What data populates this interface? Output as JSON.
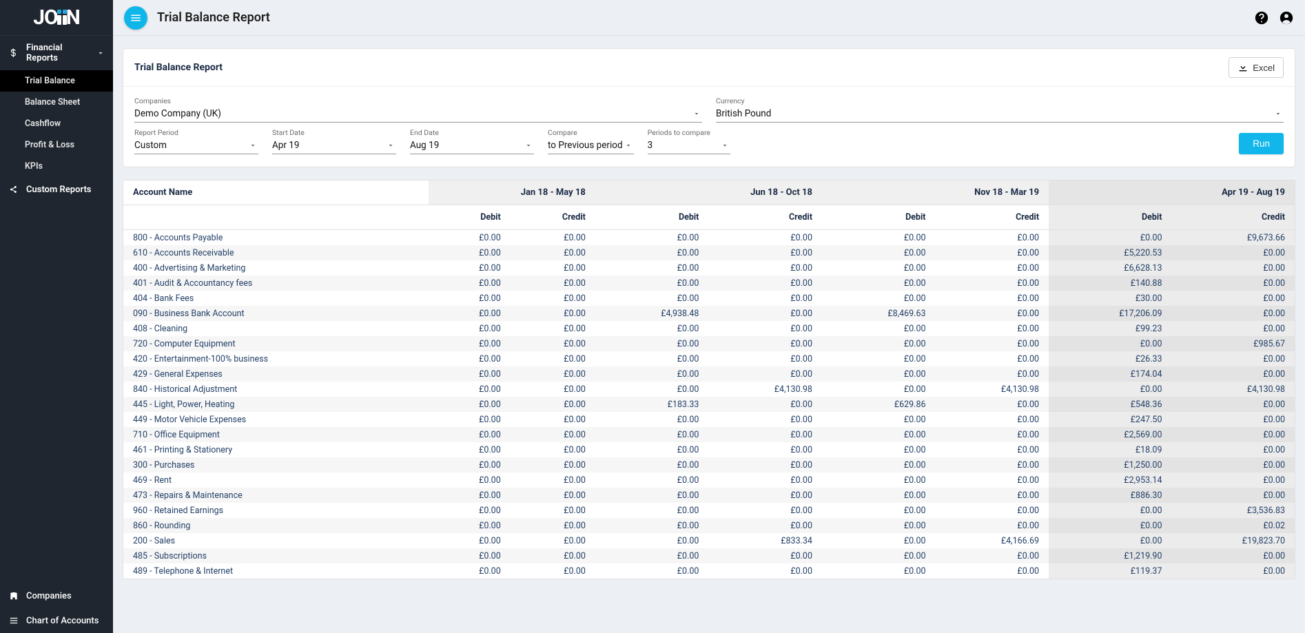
{
  "app": {
    "logo_text_left": "JO",
    "logo_text_right": "N",
    "page_title": "Trial Balance Report"
  },
  "sidebar": {
    "financial_reports_label": "Financial Reports",
    "items": [
      {
        "label": "Trial Balance",
        "active": true
      },
      {
        "label": "Balance Sheet",
        "active": false
      },
      {
        "label": "Cashflow",
        "active": false
      },
      {
        "label": "Profit & Loss",
        "active": false
      },
      {
        "label": "KPIs",
        "active": false
      }
    ],
    "custom_reports_label": "Custom Reports",
    "bottom": {
      "companies_label": "Companies",
      "coa_label": "Chart of Accounts"
    }
  },
  "report_card": {
    "title": "Trial Balance Report",
    "excel_label": "Excel",
    "filters": {
      "companies": {
        "label": "Companies",
        "value": "Demo Company (UK)"
      },
      "currency": {
        "label": "Currency",
        "value": "British Pound"
      },
      "report_period": {
        "label": "Report Period",
        "value": "Custom"
      },
      "start_date": {
        "label": "Start Date",
        "value": "Apr 19"
      },
      "end_date": {
        "label": "End Date",
        "value": "Aug 19"
      },
      "compare": {
        "label": "Compare",
        "value": "to Previous period"
      },
      "periods_to_compare": {
        "label": "Periods to compare",
        "value": "3"
      },
      "run_label": "Run"
    }
  },
  "table": {
    "account_header": "Account Name",
    "debit_label": "Debit",
    "credit_label": "Credit",
    "periods": [
      {
        "label": "Jan 18 - May 18",
        "current": false
      },
      {
        "label": "Jun 18 - Oct 18",
        "current": false
      },
      {
        "label": "Nov 18 - Mar 19",
        "current": false
      },
      {
        "label": "Apr 19 - Aug 19",
        "current": true
      }
    ],
    "rows": [
      {
        "name": "800 - Accounts Payable",
        "cells": [
          "£0.00",
          "£0.00",
          "£0.00",
          "£0.00",
          "£0.00",
          "£0.00",
          "£0.00",
          "£9,673.66"
        ]
      },
      {
        "name": "610 - Accounts Receivable",
        "cells": [
          "£0.00",
          "£0.00",
          "£0.00",
          "£0.00",
          "£0.00",
          "£0.00",
          "£5,220.53",
          "£0.00"
        ]
      },
      {
        "name": "400 - Advertising & Marketing",
        "cells": [
          "£0.00",
          "£0.00",
          "£0.00",
          "£0.00",
          "£0.00",
          "£0.00",
          "£6,628.13",
          "£0.00"
        ]
      },
      {
        "name": "401 - Audit & Accountancy fees",
        "cells": [
          "£0.00",
          "£0.00",
          "£0.00",
          "£0.00",
          "£0.00",
          "£0.00",
          "£140.88",
          "£0.00"
        ]
      },
      {
        "name": "404 - Bank Fees",
        "cells": [
          "£0.00",
          "£0.00",
          "£0.00",
          "£0.00",
          "£0.00",
          "£0.00",
          "£30.00",
          "£0.00"
        ]
      },
      {
        "name": "090 - Business Bank Account",
        "cells": [
          "£0.00",
          "£0.00",
          "£4,938.48",
          "£0.00",
          "£8,469.63",
          "£0.00",
          "£17,206.09",
          "£0.00"
        ]
      },
      {
        "name": "408 - Cleaning",
        "cells": [
          "£0.00",
          "£0.00",
          "£0.00",
          "£0.00",
          "£0.00",
          "£0.00",
          "£99.23",
          "£0.00"
        ]
      },
      {
        "name": "720 - Computer Equipment",
        "cells": [
          "£0.00",
          "£0.00",
          "£0.00",
          "£0.00",
          "£0.00",
          "£0.00",
          "£0.00",
          "£985.67"
        ]
      },
      {
        "name": "420 - Entertainment-100% business",
        "cells": [
          "£0.00",
          "£0.00",
          "£0.00",
          "£0.00",
          "£0.00",
          "£0.00",
          "£26.33",
          "£0.00"
        ]
      },
      {
        "name": "429 - General Expenses",
        "cells": [
          "£0.00",
          "£0.00",
          "£0.00",
          "£0.00",
          "£0.00",
          "£0.00",
          "£174.04",
          "£0.00"
        ]
      },
      {
        "name": "840 - Historical Adjustment",
        "cells": [
          "£0.00",
          "£0.00",
          "£0.00",
          "£4,130.98",
          "£0.00",
          "£4,130.98",
          "£0.00",
          "£4,130.98"
        ]
      },
      {
        "name": "445 - Light, Power, Heating",
        "cells": [
          "£0.00",
          "£0.00",
          "£183.33",
          "£0.00",
          "£629.86",
          "£0.00",
          "£548.36",
          "£0.00"
        ]
      },
      {
        "name": "449 - Motor Vehicle Expenses",
        "cells": [
          "£0.00",
          "£0.00",
          "£0.00",
          "£0.00",
          "£0.00",
          "£0.00",
          "£247.50",
          "£0.00"
        ]
      },
      {
        "name": "710 - Office Equipment",
        "cells": [
          "£0.00",
          "£0.00",
          "£0.00",
          "£0.00",
          "£0.00",
          "£0.00",
          "£2,569.00",
          "£0.00"
        ]
      },
      {
        "name": "461 - Printing & Stationery",
        "cells": [
          "£0.00",
          "£0.00",
          "£0.00",
          "£0.00",
          "£0.00",
          "£0.00",
          "£18.09",
          "£0.00"
        ]
      },
      {
        "name": "300 - Purchases",
        "cells": [
          "£0.00",
          "£0.00",
          "£0.00",
          "£0.00",
          "£0.00",
          "£0.00",
          "£1,250.00",
          "£0.00"
        ]
      },
      {
        "name": "469 - Rent",
        "cells": [
          "£0.00",
          "£0.00",
          "£0.00",
          "£0.00",
          "£0.00",
          "£0.00",
          "£2,953.14",
          "£0.00"
        ]
      },
      {
        "name": "473 - Repairs & Maintenance",
        "cells": [
          "£0.00",
          "£0.00",
          "£0.00",
          "£0.00",
          "£0.00",
          "£0.00",
          "£886.30",
          "£0.00"
        ]
      },
      {
        "name": "960 - Retained Earnings",
        "cells": [
          "£0.00",
          "£0.00",
          "£0.00",
          "£0.00",
          "£0.00",
          "£0.00",
          "£0.00",
          "£3,536.83"
        ]
      },
      {
        "name": "860 - Rounding",
        "cells": [
          "£0.00",
          "£0.00",
          "£0.00",
          "£0.00",
          "£0.00",
          "£0.00",
          "£0.00",
          "£0.02"
        ]
      },
      {
        "name": "200 - Sales",
        "cells": [
          "£0.00",
          "£0.00",
          "£0.00",
          "£833.34",
          "£0.00",
          "£4,166.69",
          "£0.00",
          "£19,823.70"
        ]
      },
      {
        "name": "485 - Subscriptions",
        "cells": [
          "£0.00",
          "£0.00",
          "£0.00",
          "£0.00",
          "£0.00",
          "£0.00",
          "£1,219.90",
          "£0.00"
        ]
      },
      {
        "name": "489 - Telephone & Internet",
        "cells": [
          "£0.00",
          "£0.00",
          "£0.00",
          "£0.00",
          "£0.00",
          "£0.00",
          "£119.37",
          "£0.00"
        ]
      }
    ]
  }
}
